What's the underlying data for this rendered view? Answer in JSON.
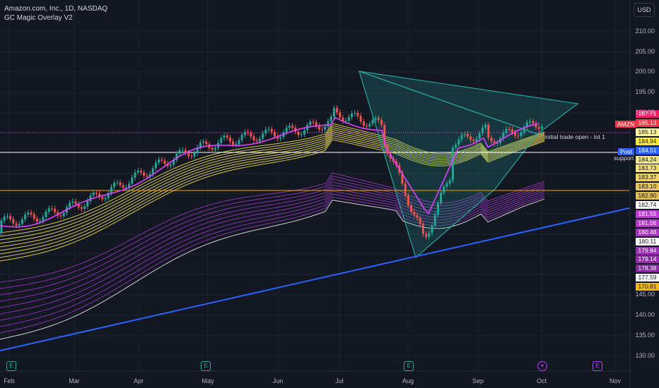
{
  "legend": {
    "symbol_line": "Amazon.com, Inc., 1D, NASDAQ",
    "indicator_line": "GC Magic Overlay V2"
  },
  "currency_button": "USD",
  "annotations": {
    "trade_open": "initial trade open - lot 1",
    "support": "support",
    "ticker_tag": "AMZN",
    "post_tag": "Post"
  },
  "price_labels": [
    {
      "text": "187.71",
      "bg": "#e91e63",
      "fg": "#ffffff"
    },
    {
      "text": "185.13",
      "bg": "#f23645",
      "fg": "#ffffff"
    },
    {
      "text": "185.13",
      "bg": "#fff59d",
      "fg": "#131722"
    },
    {
      "text": "184.94",
      "bg": "#ffeb3b",
      "fg": "#131722"
    },
    {
      "text": "184.51",
      "bg": "#2962ff",
      "fg": "#ffffff"
    },
    {
      "text": "184.24",
      "bg": "#f0e68c",
      "fg": "#131722"
    },
    {
      "text": "183.73",
      "bg": "#f7e27a",
      "fg": "#131722"
    },
    {
      "text": "183.37",
      "bg": "#efd06a",
      "fg": "#131722"
    },
    {
      "text": "183.10",
      "bg": "#e8c55d",
      "fg": "#131722"
    },
    {
      "text": "182.90",
      "bg": "#e0bc55",
      "fg": "#131722"
    },
    {
      "text": "182.74",
      "bg": "#ffffff",
      "fg": "#131722"
    },
    {
      "text": "181.55",
      "bg": "#c03ad8",
      "fg": "#ffffff"
    },
    {
      "text": "181.06",
      "bg": "#b436cc",
      "fg": "#ffffff"
    },
    {
      "text": "180.48",
      "bg": "#a833c0",
      "fg": "#ffffff"
    },
    {
      "text": "180.11",
      "bg": "#ffffff",
      "fg": "#131722"
    },
    {
      "text": "179.84",
      "bg": "#9c30b4",
      "fg": "#ffffff"
    },
    {
      "text": "179.14",
      "bg": "#902da8",
      "fg": "#ffffff"
    },
    {
      "text": "178.38",
      "bg": "#842a9c",
      "fg": "#ffffff"
    },
    {
      "text": "177.59",
      "bg": "#ffffff",
      "fg": "#131722"
    },
    {
      "text": "170.81",
      "bg": "#f0b90b",
      "fg": "#131722"
    }
  ],
  "y_axis_labels": [
    "210.00",
    "205.00",
    "200.00",
    "195.00",
    "190.00",
    "145.00",
    "140.00",
    "135.00",
    "130.00"
  ],
  "x_axis_labels": [
    "Feb",
    "Mar",
    "Apr",
    "May",
    "Jun",
    "Jul",
    "Aug",
    "Sep",
    "Oct",
    "Nov"
  ],
  "event_markers": [
    {
      "glyph": "E",
      "kind": "earnings"
    },
    {
      "glyph": "E",
      "kind": "earnings"
    },
    {
      "glyph": "E",
      "kind": "earnings"
    },
    {
      "glyph": "✦",
      "kind": "upcoming"
    },
    {
      "glyph": "E",
      "kind": "upcoming-earnings"
    }
  ],
  "colors": {
    "background": "#131722",
    "up": "#26a69a",
    "down": "#ef5350",
    "trendline": "#2962ff",
    "triangle_fill": "#26a69a",
    "ribbon_yellow": "#ffeb3b",
    "ribbon_purple": "#b43cff",
    "fast_ma": "#e040fb",
    "level_orange": "#f7a600",
    "level_white": "#ffffff"
  }
}
